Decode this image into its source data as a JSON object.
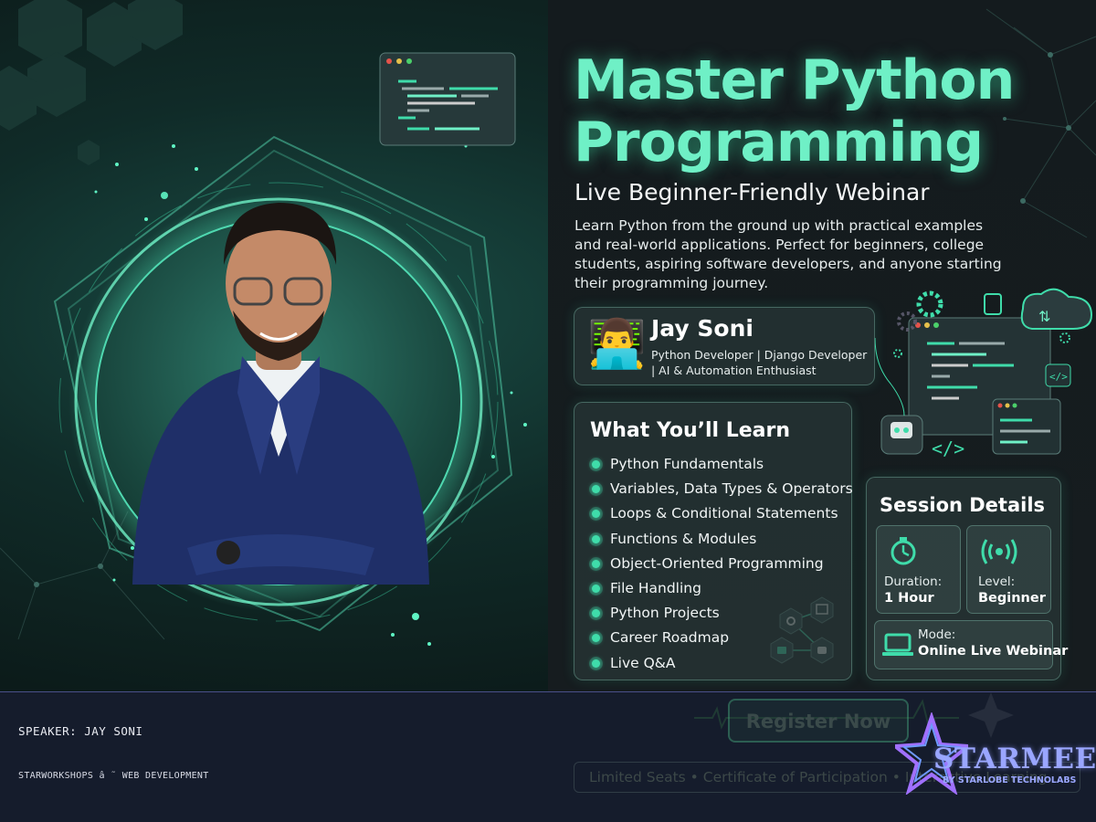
{
  "hero": {
    "title_line1": "Master Python",
    "title_line2": "Programming",
    "subtitle": "Live Beginner-Friendly Webinar",
    "description": "Learn Python from the ground up with practical examples and real-world applications. Perfect for beginners, college students, aspiring software developers, and anyone starting their programming journey."
  },
  "speaker_card": {
    "emoji": "👨‍💻",
    "name": "Jay Soni",
    "role": "Python Developer | Django Developer | AI & Automation Enthusiast"
  },
  "learn": {
    "heading": "What You’ll Learn",
    "items": [
      "Python Fundamentals",
      "Variables, Data Types & Operators",
      "Loops & Conditional Statements",
      "Functions & Modules",
      "Object-Oriented Programming",
      "File Handling",
      "Python Projects",
      "Career Roadmap",
      "Live Q&A"
    ]
  },
  "session": {
    "heading": "Session Details",
    "duration_label": "Duration:",
    "duration_value": "1 Hour",
    "level_label": "Level:",
    "level_value": "Beginner",
    "mode_label": "Mode:",
    "mode_value": "Online Live Webinar"
  },
  "footer": {
    "speaker_line": "SPEAKER: JAY SONI",
    "org_line": "STARWORKSHOPS â ˜ WEB DEVELOPMENT",
    "register_label": "Register Now",
    "features": "Limited Seats  •  Certificate of Participation  •  Interactive Learning"
  },
  "logo": {
    "name": "STARMEET",
    "tagline": "BY STARLOBE TECHNOLABS"
  },
  "colors": {
    "accent": "#3fdcaa",
    "title": "#6ff0c6",
    "footer_bg": "#151c2c",
    "logo": "#9aa6ff"
  }
}
